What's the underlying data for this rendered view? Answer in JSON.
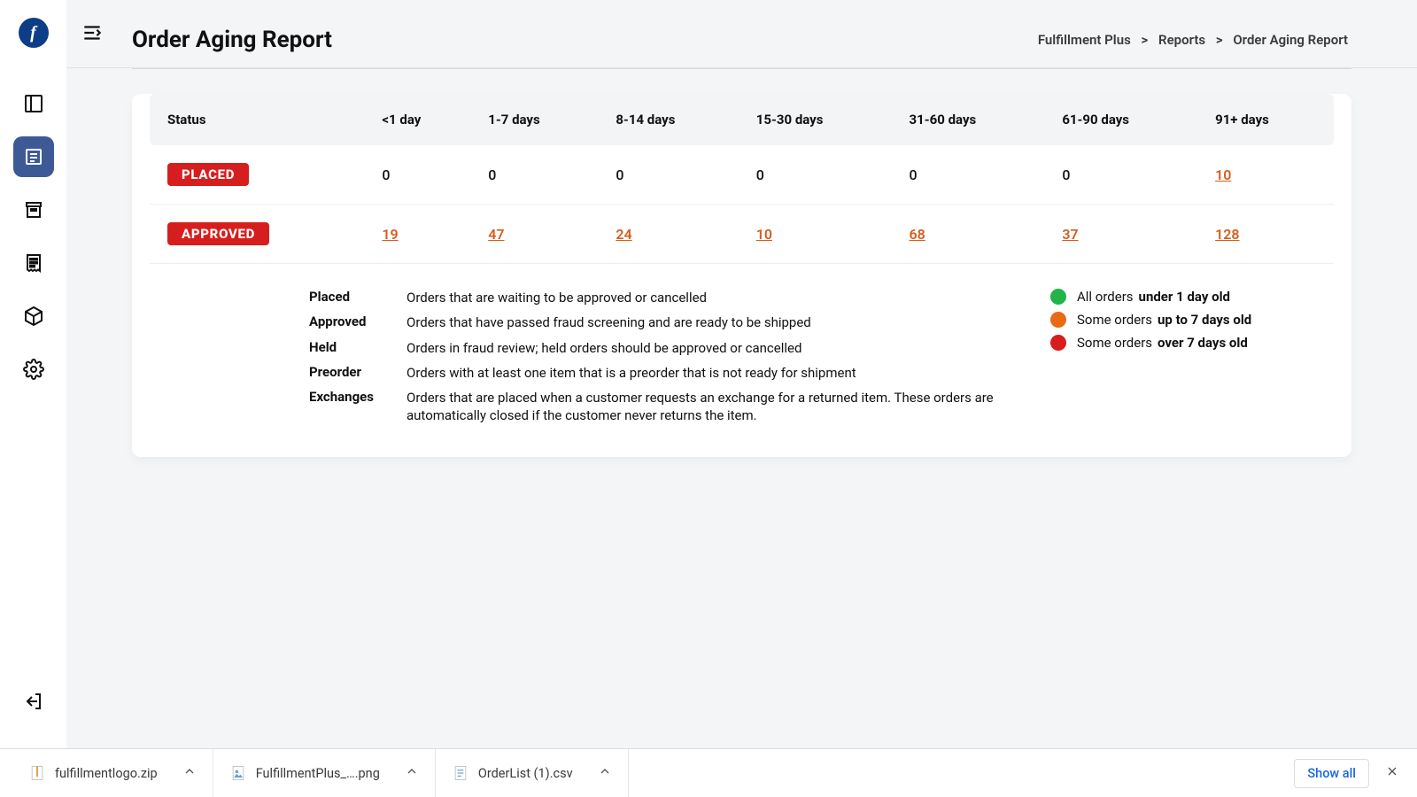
{
  "brand_letter": "f",
  "header": {
    "title": "Order Aging Report",
    "breadcrumb": {
      "a": "Fulfillment Plus",
      "sep": ">",
      "b": "Reports",
      "c": "Order Aging Report"
    }
  },
  "table": {
    "columns": [
      "Status",
      "<1 day",
      "1-7 days",
      "8-14 days",
      "15-30 days",
      "31-60 days",
      "61-90 days",
      "91+ days"
    ],
    "rows": [
      {
        "status": "PLACED",
        "cells": [
          {
            "v": "0",
            "link": false
          },
          {
            "v": "0",
            "link": false
          },
          {
            "v": "0",
            "link": false
          },
          {
            "v": "0",
            "link": false
          },
          {
            "v": "0",
            "link": false
          },
          {
            "v": "0",
            "link": false
          },
          {
            "v": "10",
            "link": true
          }
        ]
      },
      {
        "status": "APPROVED",
        "cells": [
          {
            "v": "19",
            "link": true
          },
          {
            "v": "47",
            "link": true
          },
          {
            "v": "24",
            "link": true
          },
          {
            "v": "10",
            "link": true
          },
          {
            "v": "68",
            "link": true
          },
          {
            "v": "37",
            "link": true
          },
          {
            "v": "128",
            "link": true
          }
        ]
      }
    ]
  },
  "definitions": [
    {
      "term": "Placed",
      "desc": "Orders that are waiting to be approved or cancelled"
    },
    {
      "term": "Approved",
      "desc": "Orders that have passed fraud screening and are ready to be shipped"
    },
    {
      "term": "Held",
      "desc": "Orders in fraud review; held orders should be approved or cancelled"
    },
    {
      "term": "Preorder",
      "desc": "Orders with at least one item that is a preorder that is not ready for shipment"
    },
    {
      "term": "Exchanges",
      "desc": "Orders that are placed when a customer requests an exchange for a returned item. These orders are automatically closed if the customer never returns the item."
    }
  ],
  "legend": [
    {
      "color": "#24b24b",
      "t1": "All orders",
      "t2": "under 1 day old"
    },
    {
      "color": "#e86a15",
      "t1": "Some orders",
      "t2": "up to 7 days old"
    },
    {
      "color": "#d71e1e",
      "t1": "Some orders",
      "t2": "over 7 days old"
    }
  ],
  "downloads": {
    "items": [
      {
        "name": "fulfillmentlogo.zip",
        "icon": "zip"
      },
      {
        "name": "FulfillmentPlus_….png",
        "icon": "png"
      },
      {
        "name": "OrderList (1).csv",
        "icon": "csv"
      }
    ],
    "show_all": "Show all"
  }
}
